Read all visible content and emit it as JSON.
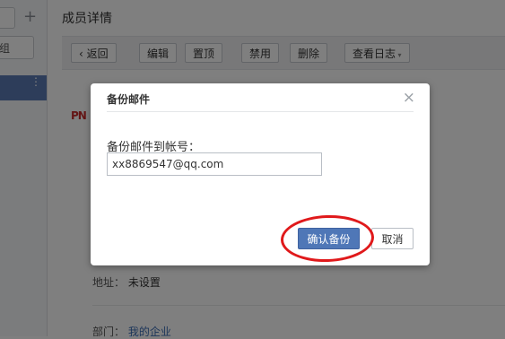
{
  "sidebar": {
    "group_fragment": "组",
    "add_symbol": "+",
    "more_symbol": "⋮"
  },
  "header": {
    "title": "成员详情"
  },
  "toolbar": {
    "back_label": "返回",
    "edit_label": "编辑",
    "pin_label": "置顶",
    "disable_label": "禁用",
    "delete_label": "删除",
    "log_label": "查看日志"
  },
  "profile": {
    "logo_text": "PN",
    "address_label": "地址：",
    "address_value": "未设置",
    "department_label": "部门：",
    "department_value": "我的企业"
  },
  "modal": {
    "title": "备份邮件",
    "close_symbol": "×",
    "field_label": "备份邮件到帐号：",
    "field_value": "xx8869547@qq.com",
    "confirm_label": "确认备份",
    "cancel_label": "取消"
  },
  "colors": {
    "accent": "#4f77b7",
    "annotation": "#e0191b",
    "overlay": "rgba(0,0,0,0.5)"
  }
}
